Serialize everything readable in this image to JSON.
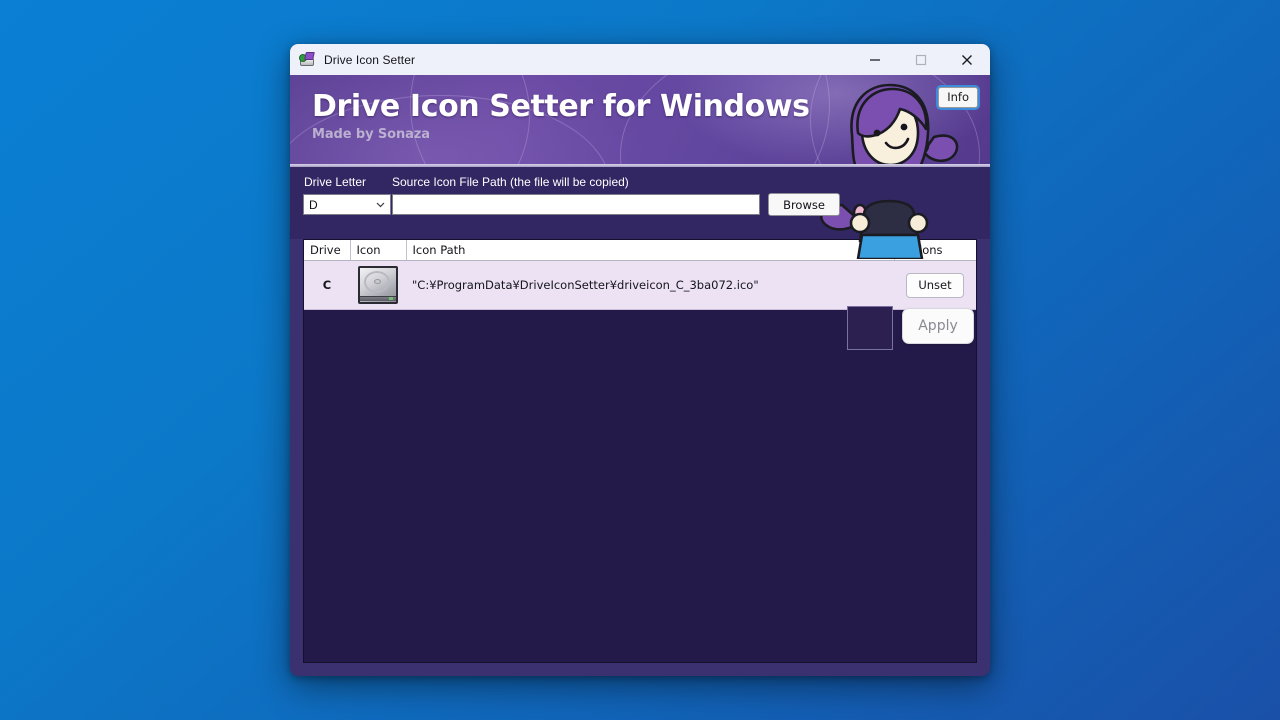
{
  "window": {
    "title": "Drive Icon Setter",
    "app_icon": "drive-icon",
    "minimize_label": "Minimize",
    "maximize_label": "Maximize",
    "close_label": "Close"
  },
  "hero": {
    "title": "Drive Icon Setter for Windows",
    "subtitle": "Made by Sonaza",
    "info_button": "Info",
    "accent_color": "#6247a0",
    "mascot": "mascot-illustration"
  },
  "controls": {
    "drive_letter_label": "Drive Letter",
    "drive_letter_value": "D",
    "drive_letter_options": [
      "D"
    ],
    "source_path_label": "Source Icon File Path (the file will be copied)",
    "source_path_value": "",
    "source_path_placeholder": "",
    "browse_label": "Browse",
    "apply_label": "Apply",
    "preview_label": "icon-preview"
  },
  "table": {
    "columns": [
      "Drive",
      "Icon",
      "Icon Path",
      "Actions"
    ],
    "rows": [
      {
        "drive": "C",
        "icon": "hard-drive-icon",
        "path": "\"C:¥ProgramData¥DriveIconSetter¥driveicon_C_3ba072.ico\"",
        "action_label": "Unset"
      }
    ]
  }
}
